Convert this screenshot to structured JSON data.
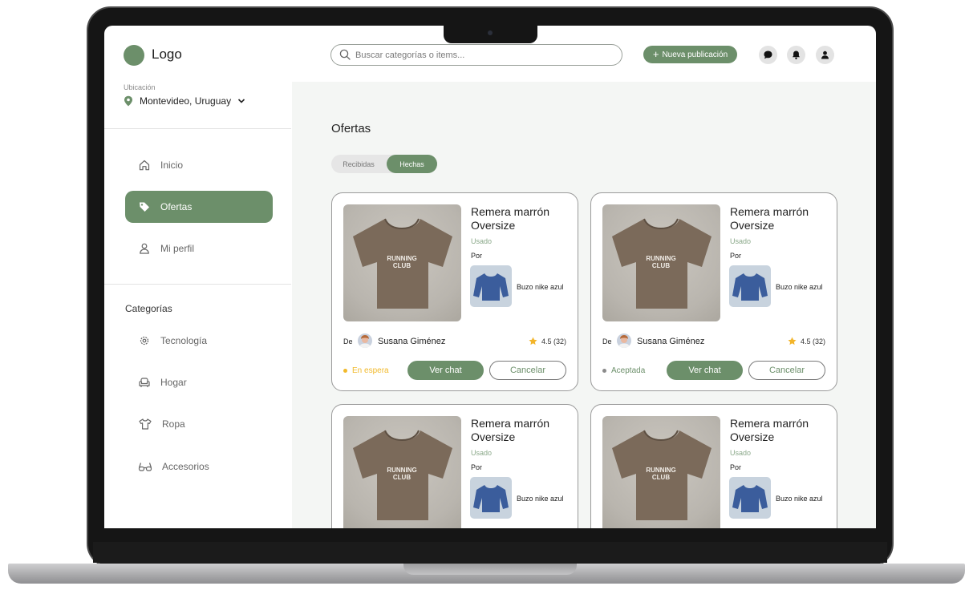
{
  "header": {
    "logo": "Logo",
    "search_placeholder": "Buscar categorías o items...",
    "new_post": "Nueva publicación"
  },
  "location": {
    "label": "Ubicación",
    "value": "Montevideo, Uruguay"
  },
  "nav": {
    "inicio": "Inicio",
    "ofertas": "Ofertas",
    "perfil": "Mi perfil"
  },
  "categories": {
    "title": "Categorías",
    "items": [
      "Tecnología",
      "Hogar",
      "Ropa",
      "Accesorios"
    ]
  },
  "main": {
    "title": "Ofertas",
    "tabs": [
      "Recibidas",
      "Hechas"
    ],
    "active_tab": "Hechas"
  },
  "offers": [
    {
      "title": "Remera marrón Oversize",
      "condition": "Usado",
      "por": "Por",
      "swap_item": "Buzo nike azul",
      "de": "De",
      "seller": "Susana Giménez",
      "rating": "4.5 (32)",
      "status": "En espera",
      "chat": "Ver chat",
      "cancel": "Cancelar"
    },
    {
      "title": "Remera marrón Oversize",
      "condition": "Usado",
      "por": "Por",
      "swap_item": "Buzo nike azul",
      "de": "De",
      "seller": "Susana Giménez",
      "rating": "4.5 (32)",
      "status": "Aceptada",
      "chat": "Ver chat",
      "cancel": "Cancelar"
    },
    {
      "title": "Remera marrón Oversize",
      "condition": "Usado",
      "por": "Por",
      "swap_item": "Buzo nike azul"
    },
    {
      "title": "Remera marrón Oversize",
      "condition": "Usado",
      "por": "Por",
      "swap_item": "Buzo nike azul"
    }
  ],
  "product_image_text": {
    "line1": "RUNNING",
    "line2": "CLUB"
  },
  "colors": {
    "accent": "#6c8f6a",
    "pending": "#f1b92b",
    "accepted": "#8a8a8a",
    "star": "#f3b52a"
  }
}
